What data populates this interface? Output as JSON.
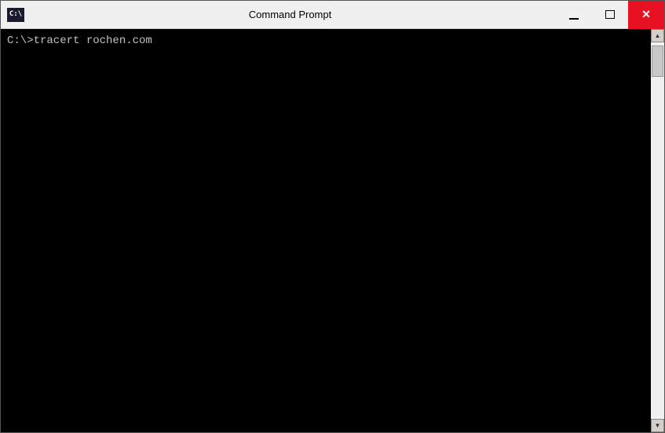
{
  "window": {
    "title": "Command Prompt",
    "icon_label": "C:\\",
    "icon_text": "C:\\"
  },
  "controls": {
    "minimize_label": "−",
    "maximize_label": "□",
    "close_label": "✕"
  },
  "terminal": {
    "line1": "C:\\>tracert rochen.com"
  },
  "scrollbar": {
    "arrow_up": "▲",
    "arrow_down": "▼"
  }
}
